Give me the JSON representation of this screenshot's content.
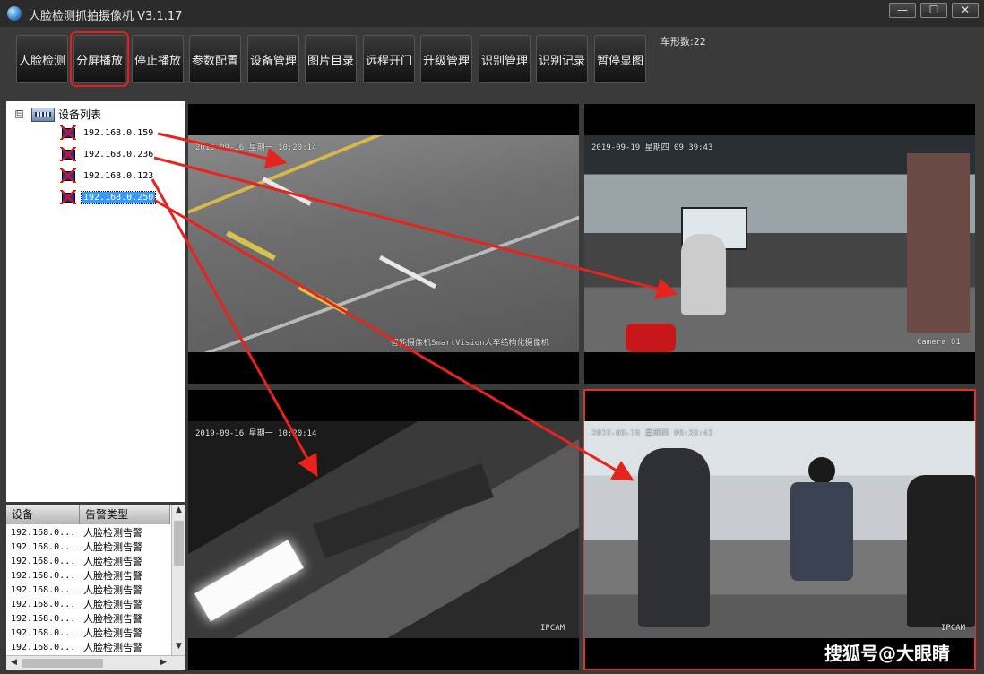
{
  "window": {
    "title": "人脸检测抓拍摄像机  V3.1.17",
    "min_label": "—",
    "max_label": "☐",
    "close_label": "✕"
  },
  "toolbar": {
    "buttons": [
      {
        "label": "人脸检测"
      },
      {
        "label": "分屏播放",
        "active": true
      },
      {
        "label": "停止播放"
      },
      {
        "label": "参数配置"
      },
      {
        "label": "设备管理"
      },
      {
        "label": "图片目录"
      },
      {
        "label": "远程开门"
      },
      {
        "label": "升级管理"
      },
      {
        "label": "识别管理"
      },
      {
        "label": "识别记录"
      },
      {
        "label": "暂停显图"
      }
    ],
    "count_label": "车形数:22"
  },
  "device_tree": {
    "root_label": "设备列表",
    "expander": "⊟",
    "devices": [
      {
        "ip": "192.168.0.159"
      },
      {
        "ip": "192.168.0.236"
      },
      {
        "ip": "192.168.0.123"
      },
      {
        "ip": "192.168.0.250",
        "selected": true
      }
    ]
  },
  "alarm_list": {
    "columns": [
      "设备",
      "告警类型"
    ],
    "rows": [
      {
        "device": "192.168.0...",
        "type": "人脸检测告警"
      },
      {
        "device": "192.168.0...",
        "type": "人脸检测告警"
      },
      {
        "device": "192.168.0...",
        "type": "人脸检测告警"
      },
      {
        "device": "192.168.0...",
        "type": "人脸检测告警"
      },
      {
        "device": "192.168.0...",
        "type": "人脸检测告警"
      },
      {
        "device": "192.168.0...",
        "type": "人脸检测告警"
      },
      {
        "device": "192.168.0...",
        "type": "人脸检测告警"
      },
      {
        "device": "192.168.0...",
        "type": "人脸检测告警"
      },
      {
        "device": "192.168.0...",
        "type": "人脸检测告警"
      }
    ]
  },
  "videos": [
    {
      "timestamp": "2019-09-16 星期一 10:20:14",
      "caption": "智能摄像机SmartVision人车结构化摄像机"
    },
    {
      "timestamp": "2019-09-19 星期四 09:39:43",
      "caption": "Camera 01"
    },
    {
      "timestamp": "2019-09-16 星期一 10:20:14",
      "caption": "IPCAM"
    },
    {
      "timestamp": "2019-09-19 星期四 09:39:43",
      "caption": "IPCAM"
    }
  ],
  "watermark": "搜狐号@大眼睛",
  "colors": {
    "highlight": "#e02020",
    "selection": "#3399ff",
    "arrow": "#e8231e"
  },
  "icons": {
    "app": "globe-icon",
    "device": "camera-icon",
    "root": "device-list-icon"
  }
}
